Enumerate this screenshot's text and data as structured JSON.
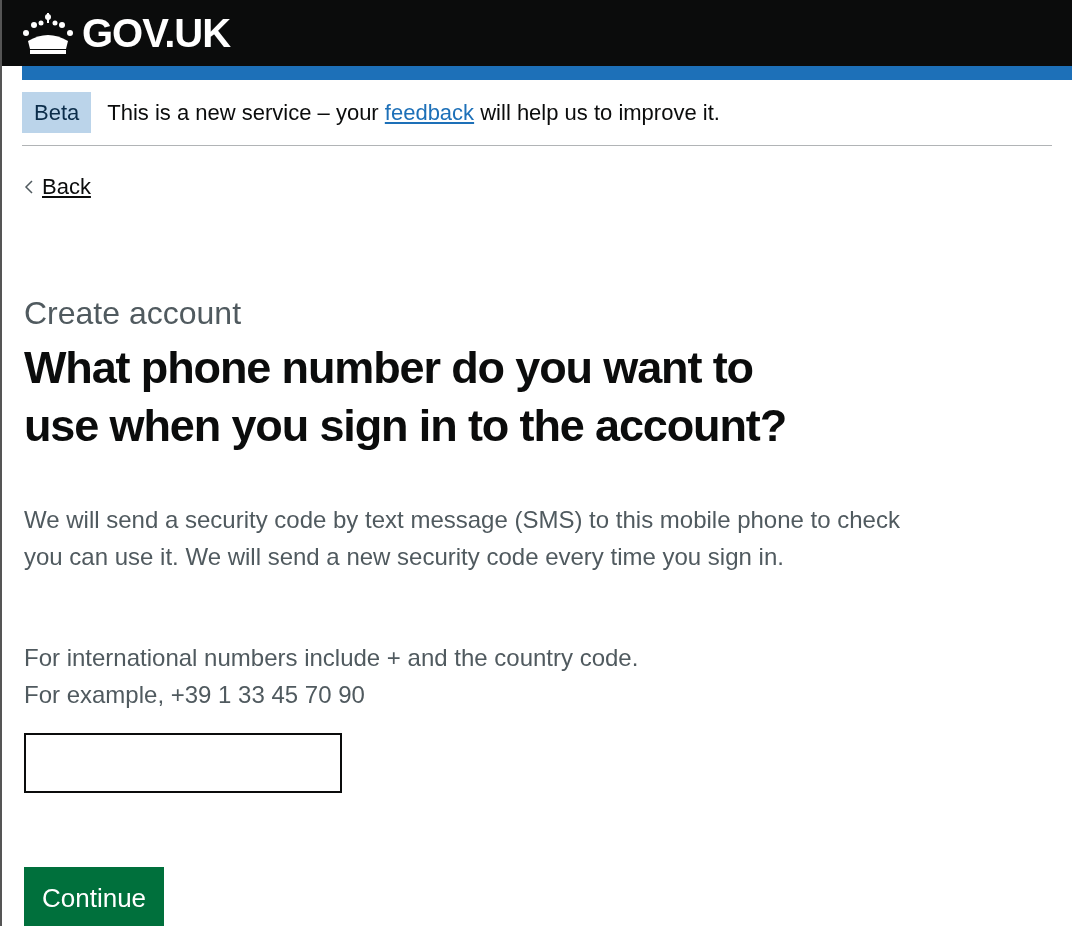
{
  "header": {
    "logo": "GOV.UK"
  },
  "phase_banner": {
    "tag": "Beta",
    "text_before": "This is a new service – your ",
    "link": "feedback",
    "text_after": " will help us to improve it."
  },
  "back_link": "Back",
  "caption": "Create account",
  "heading": "What phone number do you want to use when you sign in to the account?",
  "body": "We will send a security code by text message (SMS) to this mobile phone to check you can use it. We will send a new security code every time you sign in.",
  "hint": [
    "For international numbers include + and the country code.",
    "For example, +39 1 33 45 70 90"
  ],
  "continue_button": "Continue"
}
